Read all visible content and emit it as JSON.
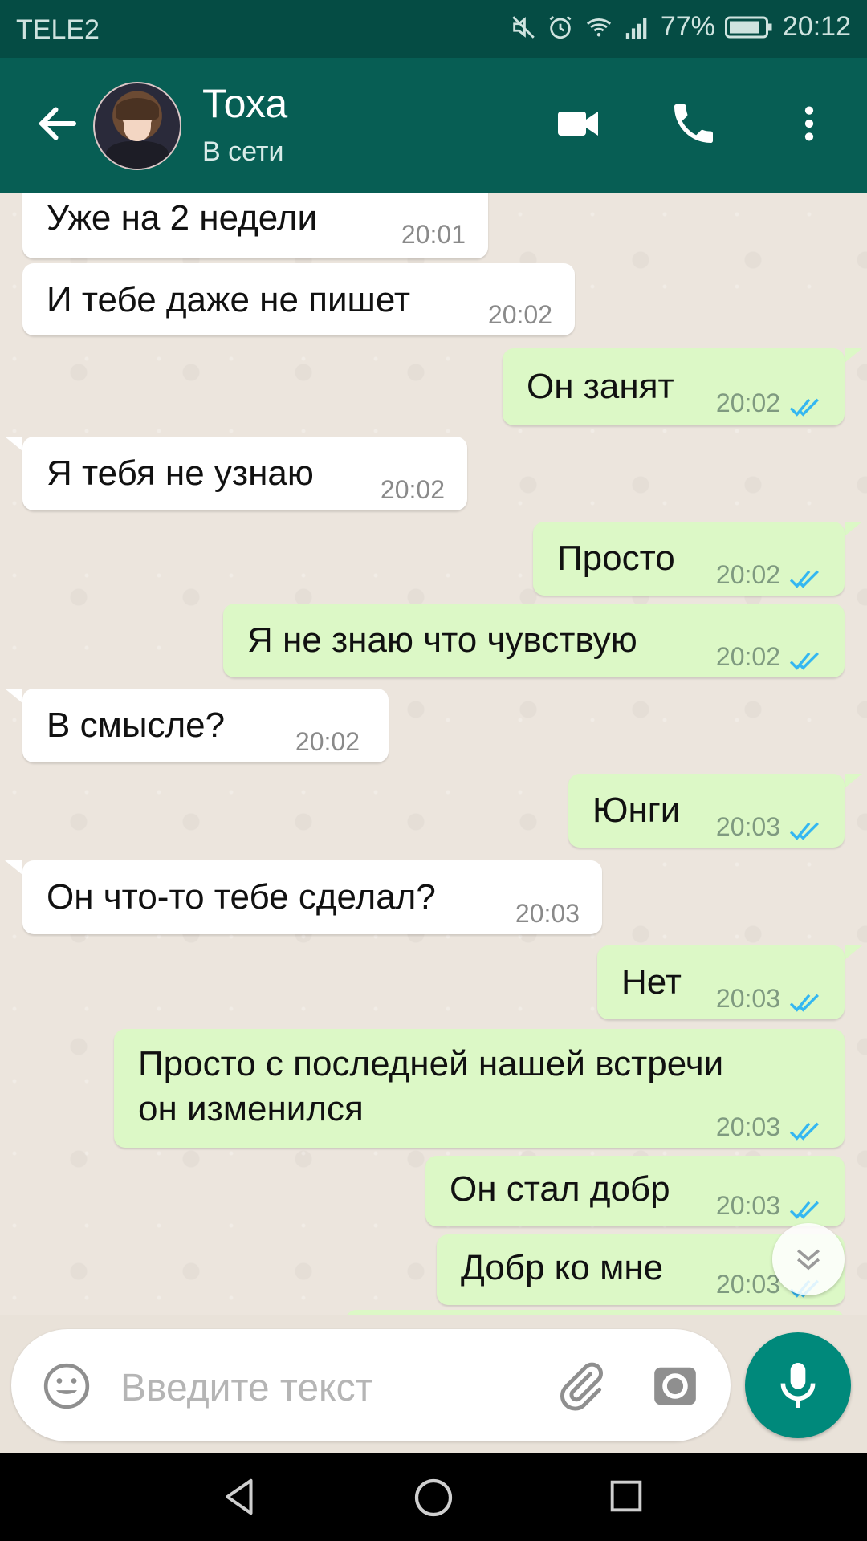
{
  "status_bar": {
    "carrier": "TELE2",
    "battery": "77%",
    "time": "20:12",
    "icons": [
      "mute-icon",
      "alarm-icon",
      "wifi-icon",
      "signal-icon",
      "battery-icon"
    ]
  },
  "header": {
    "contact_name": "Тоха",
    "contact_status": "В сети",
    "icons": [
      "back-arrow-icon",
      "avatar",
      "video-call-icon",
      "phone-icon",
      "more-vert-icon"
    ]
  },
  "messages": [
    {
      "dir": "in",
      "text": "Уже на 2 недели",
      "time": "20:01"
    },
    {
      "dir": "in",
      "text": "И тебе даже не пишет",
      "time": "20:02"
    },
    {
      "dir": "out",
      "text": "Он занят",
      "time": "20:02",
      "read": true
    },
    {
      "dir": "in",
      "text": "Я тебя не узнаю",
      "time": "20:02"
    },
    {
      "dir": "out",
      "text": "Просто",
      "time": "20:02",
      "read": true
    },
    {
      "dir": "out",
      "text": "Я не знаю что чувствую",
      "time": "20:02",
      "read": true
    },
    {
      "dir": "in",
      "text": "В смысле?",
      "time": "20:02"
    },
    {
      "dir": "out",
      "text": "Юнги",
      "time": "20:03",
      "read": true
    },
    {
      "dir": "in",
      "text": "Он что-то тебе сделал?",
      "time": "20:03"
    },
    {
      "dir": "out",
      "text": "Нет",
      "time": "20:03",
      "read": true
    },
    {
      "dir": "out",
      "text": "Просто с последней нашей встречи\nон изменился",
      "time": "20:03",
      "read": true
    },
    {
      "dir": "out",
      "text": "Он стал добр",
      "time": "20:03",
      "read": true
    },
    {
      "dir": "out",
      "text": "Добр ко мне",
      "time": "20:03",
      "read": true
    }
  ],
  "composer": {
    "placeholder": "Введите текст",
    "icons": [
      "emoji-icon",
      "attach-icon",
      "camera-icon",
      "mic-icon"
    ]
  },
  "colors": {
    "header": "#075e54",
    "status_bar": "#054c44",
    "incoming_bubble": "#ffffff",
    "outgoing_bubble": "#dcf8c6",
    "read_ticks": "#34b7f1",
    "mic_button": "#00897b"
  },
  "nav_bar": {
    "icons": [
      "nav-back-icon",
      "nav-home-icon",
      "nav-recents-icon"
    ]
  }
}
